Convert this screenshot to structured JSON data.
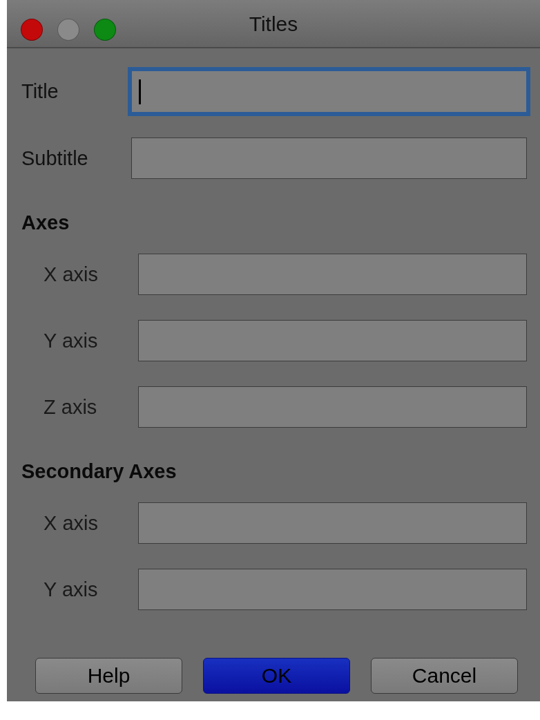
{
  "window": {
    "title": "Titles"
  },
  "window_controls": [
    {
      "kind": "close",
      "disabled": false
    },
    {
      "kind": "minimize",
      "disabled": true
    },
    {
      "kind": "zoom",
      "disabled": false
    }
  ],
  "main_fields": [
    {
      "label": "Title",
      "focused": true
    },
    {
      "label": "Subtitle",
      "focused": false
    }
  ],
  "sections": [
    {
      "heading": "Axes",
      "fields": [
        {
          "label": "X axis",
          "focused": false
        },
        {
          "label": "Y axis",
          "focused": false
        },
        {
          "label": "Z axis",
          "focused": false
        }
      ]
    },
    {
      "heading": "Secondary Axes",
      "fields": [
        {
          "label": "X axis",
          "focused": false
        },
        {
          "label": "Y axis",
          "focused": false
        }
      ]
    }
  ],
  "buttons": [
    {
      "label": "Help",
      "default": false
    },
    {
      "label": "OK",
      "default": true
    },
    {
      "label": "Cancel",
      "default": false
    }
  ]
}
